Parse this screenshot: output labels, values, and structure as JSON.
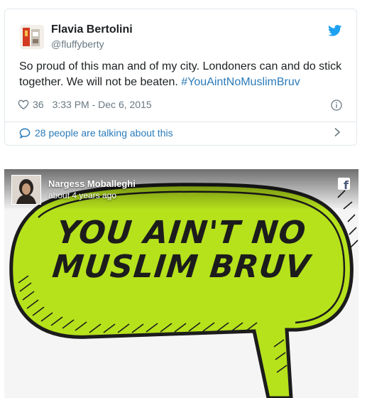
{
  "tweet": {
    "display_name": "Flavia Bertolini",
    "handle": "@fluffyberty",
    "text_before_hashtag": "So proud of this man and of my city. Londoners can and do stick together. We will not be beaten. ",
    "hashtag": "#YouAintNoMuslimBruv",
    "like_count": "36",
    "timestamp": "3:33 PM - Dec 6, 2015",
    "talking_about": "28 people are talking about this",
    "colors": {
      "link": "#2b7bb9",
      "meta": "#697882",
      "border": "#e1e8ed"
    }
  },
  "media": {
    "author_name": "Nargess Moballeghi",
    "posted_ago": "about 4 years ago",
    "graphic_line1": "YOU AIN'T NO",
    "graphic_line2": "MUSLIM BRUV",
    "colors": {
      "bubble": "#b6e21c",
      "outline": "#1c1c1c"
    }
  }
}
